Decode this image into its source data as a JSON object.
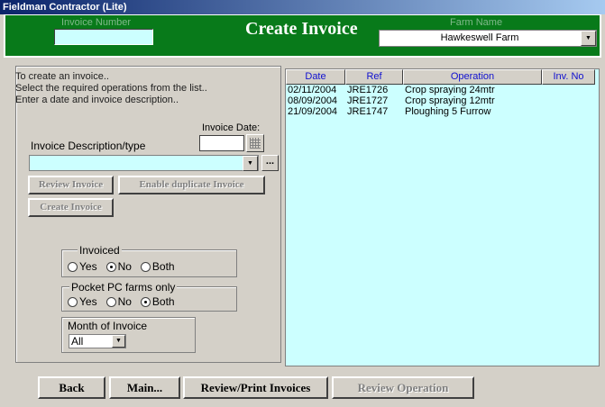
{
  "window": {
    "title": "Fieldman Contractor (Lite)"
  },
  "header": {
    "invoice_number_label": "Invoice Number",
    "invoice_number_value": "",
    "title": "Create Invoice",
    "farm_name_label": "Farm Name",
    "farm_name_value": "Hawkeswell Farm"
  },
  "instructions": {
    "line1": "To create an invoice..",
    "line2": "Select the required operations from the list..",
    "line3": "Enter a date and invoice description.."
  },
  "form": {
    "invoice_date_label": "Invoice Date:",
    "invoice_date_value": "",
    "description_label": "Invoice Description/type",
    "description_value": "",
    "ellipsis": "..."
  },
  "buttons": {
    "review_invoice": "Review Invoice",
    "enable_duplicate": "Enable duplicate Invoice",
    "create_invoice": "Create Invoice"
  },
  "filters": {
    "invoiced": {
      "legend": "Invoiced",
      "options": [
        "Yes",
        "No",
        "Both"
      ],
      "selected": "No"
    },
    "pocket_pc": {
      "legend": "Pocket PC farms only",
      "options": [
        "Yes",
        "No",
        "Both"
      ],
      "selected": "Both"
    },
    "month": {
      "legend": "Month of Invoice",
      "value": "All"
    }
  },
  "table": {
    "columns": [
      "Date",
      "Ref",
      "Operation",
      "Inv. No"
    ],
    "rows": [
      [
        "02/11/2004",
        "JRE1726",
        "Crop spraying 24mtr",
        ""
      ],
      [
        "08/09/2004",
        "JRE1727",
        "Crop spraying 12mtr",
        ""
      ],
      [
        "21/09/2004",
        "JRE1747",
        "Ploughing 5 Furrow",
        ""
      ]
    ]
  },
  "bottom": {
    "back": "Back",
    "main": "Main...",
    "review_print": "Review/Print Invoices",
    "review_operation": "Review Operation"
  },
  "colors": {
    "header_green": "#087a1a",
    "table_bg": "#ccffff",
    "title_blue": "#0a246a"
  }
}
